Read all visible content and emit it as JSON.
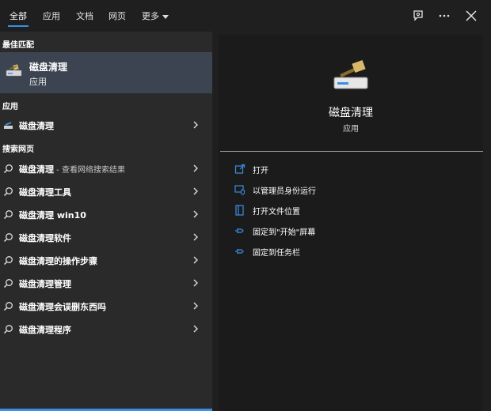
{
  "tabs": [
    "全部",
    "应用",
    "文档",
    "网页",
    "更多"
  ],
  "left": {
    "best_match_header": "最佳匹配",
    "best_match": {
      "title": "磁盘清理",
      "subtitle": "应用"
    },
    "apps_header": "应用",
    "apps": [
      {
        "label": "磁盘清理"
      }
    ],
    "web_header": "搜索网页",
    "web_results": [
      {
        "label": "磁盘清理",
        "suffix": " - 查看网络搜索结果"
      },
      {
        "label": "磁盘清理工具",
        "suffix": ""
      },
      {
        "label": "磁盘清理 win10",
        "suffix": ""
      },
      {
        "label": "磁盘清理软件",
        "suffix": ""
      },
      {
        "label": "磁盘清理的操作步骤",
        "suffix": ""
      },
      {
        "label": "磁盘清理管理",
        "suffix": ""
      },
      {
        "label": "磁盘清理会误删东西吗",
        "suffix": ""
      },
      {
        "label": "磁盘清理程序",
        "suffix": ""
      }
    ]
  },
  "right": {
    "title": "磁盘清理",
    "subtitle": "应用",
    "actions": [
      {
        "label": "打开",
        "icon": "open-icon"
      },
      {
        "label": "以管理员身份运行",
        "icon": "admin-shield-icon"
      },
      {
        "label": "打开文件位置",
        "icon": "file-location-icon"
      },
      {
        "label": "固定到\"开始\"屏幕",
        "icon": "pin-icon"
      },
      {
        "label": "固定到任务栏",
        "icon": "pin-icon"
      }
    ]
  },
  "colors": {
    "accent": "#3a8ee6",
    "selected_row": "#3b4450"
  }
}
